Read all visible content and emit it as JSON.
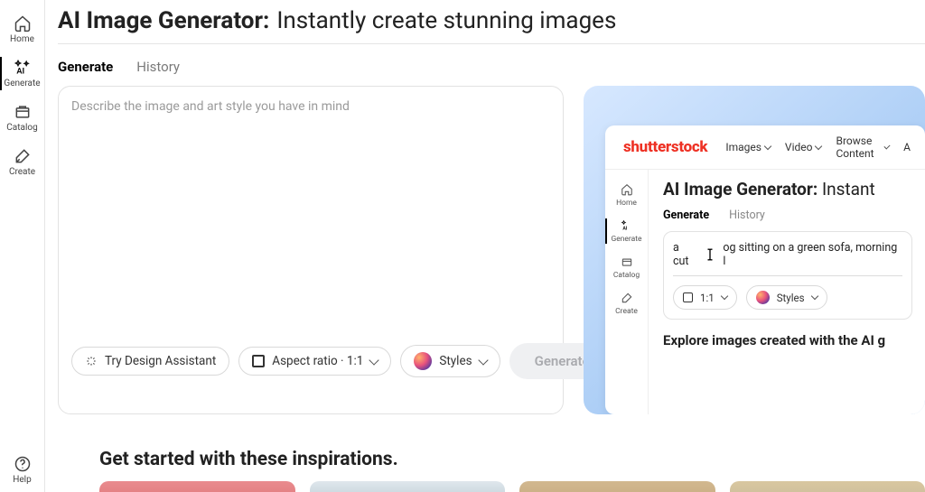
{
  "sidebar": {
    "items": [
      {
        "label": "Home"
      },
      {
        "label": "Generate"
      },
      {
        "label": "Catalog"
      },
      {
        "label": "Create"
      }
    ],
    "help_label": "Help"
  },
  "page": {
    "title_bold": "AI Image Generator:",
    "title_light": "Instantly create stunning images"
  },
  "tabs": [
    {
      "label": "Generate",
      "active": true
    },
    {
      "label": "History",
      "active": false
    }
  ],
  "prompt": {
    "placeholder": "Describe the image and art style you have in mind",
    "assistant_label": "Try Design Assistant",
    "aspect_label": "Aspect ratio · 1:1",
    "styles_label": "Styles",
    "generate_label": "Generate"
  },
  "preview": {
    "brand": "shutterstock",
    "nav": [
      "Images",
      "Video",
      "Browse Content",
      "A"
    ],
    "sidebar": [
      "Home",
      "Generate",
      "Catalog",
      "Create"
    ],
    "title_bold": "AI Image Generator:",
    "title_light": "Instant",
    "tabs": [
      "Generate",
      "History"
    ],
    "typed_prefix": "a cut",
    "typed_mid": "og sitting on a green sofa, morning l",
    "aspect_pill": "1:1",
    "styles_pill": "Styles",
    "explore_heading": "Explore images created with the AI g"
  },
  "inspirations": {
    "heading": "Get started with these inspirations."
  }
}
